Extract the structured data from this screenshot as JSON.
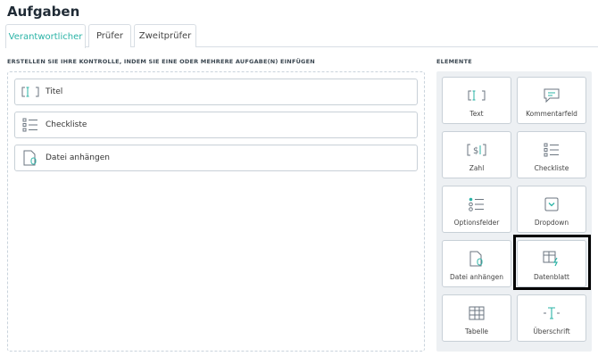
{
  "page": {
    "title": "Aufgaben"
  },
  "tabs": [
    {
      "label": "Verantwortlicher",
      "active": true
    },
    {
      "label": "Prüfer",
      "active": false
    },
    {
      "label": "Zweitprüfer",
      "active": false
    }
  ],
  "left_section": {
    "label": "ERSTELLEN SIE IHRE KONTROLLE, INDEM SIE EINE ODER MEHRERE AUFGABE(N) EINFÜGEN",
    "tasks": [
      {
        "label": "Titel",
        "icon": "text-field-icon"
      },
      {
        "label": "Checkliste",
        "icon": "checklist-icon"
      },
      {
        "label": "Datei anhängen",
        "icon": "file-attach-icon"
      }
    ]
  },
  "elements_section": {
    "label": "ELEMENTE",
    "items": [
      {
        "label": "Text",
        "icon": "text-field-icon"
      },
      {
        "label": "Kommentarfeld",
        "icon": "comment-icon"
      },
      {
        "label": "Zahl",
        "icon": "number-field-icon"
      },
      {
        "label": "Checkliste",
        "icon": "checklist-icon"
      },
      {
        "label": "Optionsfelder",
        "icon": "radio-options-icon"
      },
      {
        "label": "Dropdown",
        "icon": "dropdown-icon"
      },
      {
        "label": "Datei anhängen",
        "icon": "file-attach-icon"
      },
      {
        "label": "Datenblatt",
        "icon": "datasheet-icon",
        "highlighted": true
      },
      {
        "label": "Tabelle",
        "icon": "table-icon"
      },
      {
        "label": "Überschrift",
        "icon": "heading-icon"
      }
    ]
  },
  "colors": {
    "accent": "#2ab3a6",
    "icon_gray": "#6b7680",
    "border": "#c8d0d7",
    "panel_bg": "#edf0f3"
  }
}
